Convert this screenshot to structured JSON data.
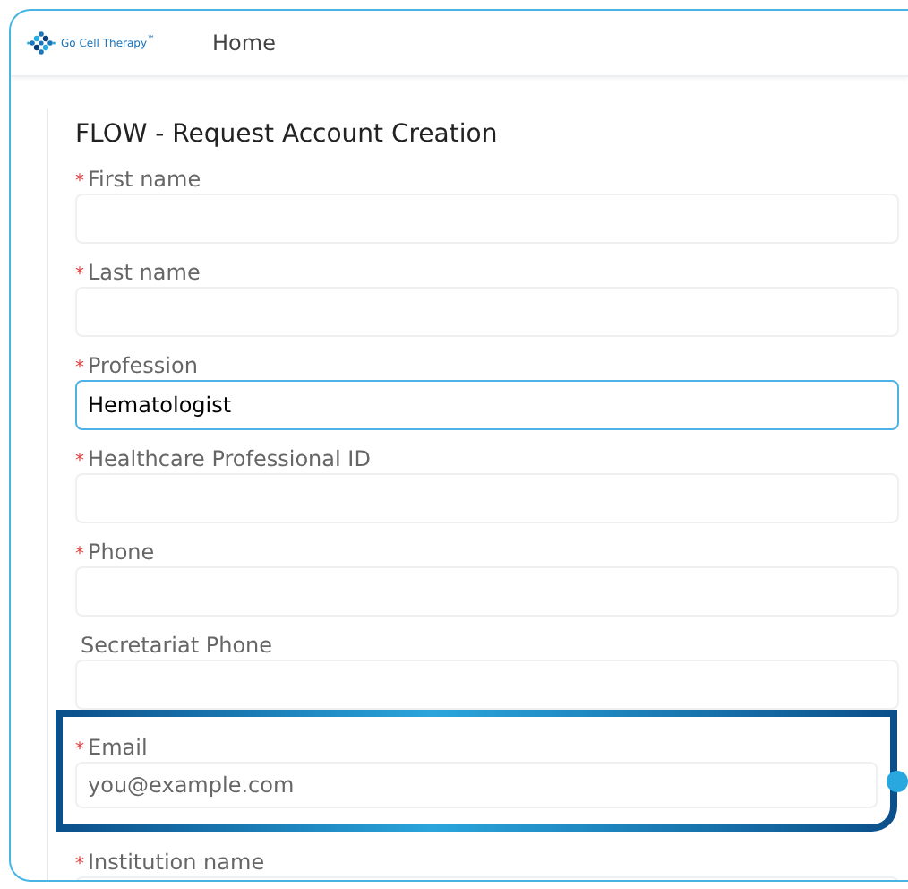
{
  "header": {
    "logo_text": "Go Cell Therapy",
    "logo_mark": "™",
    "nav": [
      {
        "label": "Home"
      }
    ]
  },
  "form": {
    "title": "FLOW - Request Account Creation",
    "fields": [
      {
        "required_mark": "*",
        "label": "First name",
        "focused": false,
        "highlighted": false
      },
      {
        "required_mark": "*",
        "label": "Last name",
        "focused": false,
        "highlighted": false
      },
      {
        "required_mark": "*",
        "label": "Profession",
        "value": "Hematologist",
        "focused": true,
        "highlighted": false
      },
      {
        "required_mark": "*",
        "label": "Healthcare Professional ID",
        "focused": false,
        "highlighted": false
      },
      {
        "required_mark": "*",
        "label": "Phone",
        "focused": false,
        "highlighted": false
      },
      {
        "label": "Secretariat Phone",
        "focused": false,
        "highlighted": false
      },
      {
        "required_mark": "*",
        "label": "Email",
        "placeholder": "you@example.com",
        "focused": false,
        "highlighted": true
      },
      {
        "required_mark": "*",
        "label": "Institution name",
        "focused": false,
        "highlighted": false
      }
    ]
  }
}
